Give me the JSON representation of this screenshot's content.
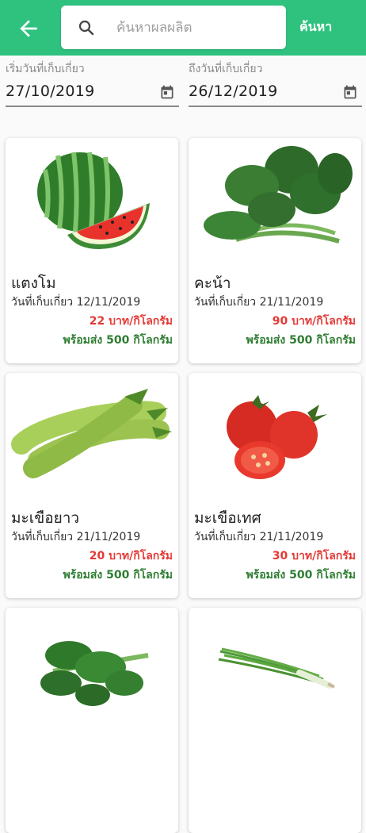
{
  "header": {
    "search_placeholder": "ค้นหาผลผลิต",
    "search_button": "ค้นหา",
    "accent_color": "#2ec27e"
  },
  "filters": {
    "from_label": "เริ่มวันที่เก็บเกี่ยว",
    "from_value": "27/10/2019",
    "to_label": "ถึงวันที่เก็บเกี่ยว",
    "to_value": "26/12/2019"
  },
  "products": [
    {
      "name": "แตงโม",
      "date": "วันที่เก็บเกี่ยว 12/11/2019",
      "price": "22 บาท/กิโลกรัม",
      "stock": "พร้อมส่ง 500 กิโลกรัม",
      "image": "watermelon-image"
    },
    {
      "name": "คะน้า",
      "date": "วันที่เก็บเกี่ยว 21/11/2019",
      "price": "90 บาท/กิโลกรัม",
      "stock": "พร้อมส่ง 500 กิโลกรัม",
      "image": "kale-image"
    },
    {
      "name": "มะเขือยาว",
      "date": "วันที่เก็บเกี่ยว 21/11/2019",
      "price": "20 บาท/กิโลกรัม",
      "stock": "พร้อมส่ง 500 กิโลกรัม",
      "image": "eggplant-image"
    },
    {
      "name": "มะเขือเทศ",
      "date": "วันที่เก็บเกี่ยว 21/11/2019",
      "price": "30 บาท/กิโลกรัม",
      "stock": "พร้อมส่ง 500 กิโลกรัม",
      "image": "tomato-image"
    },
    {
      "name": "",
      "date": "",
      "price": "",
      "stock": "",
      "image": "choy-sum-image"
    },
    {
      "name": "",
      "date": "",
      "price": "",
      "stock": "",
      "image": "green-onion-image"
    }
  ]
}
